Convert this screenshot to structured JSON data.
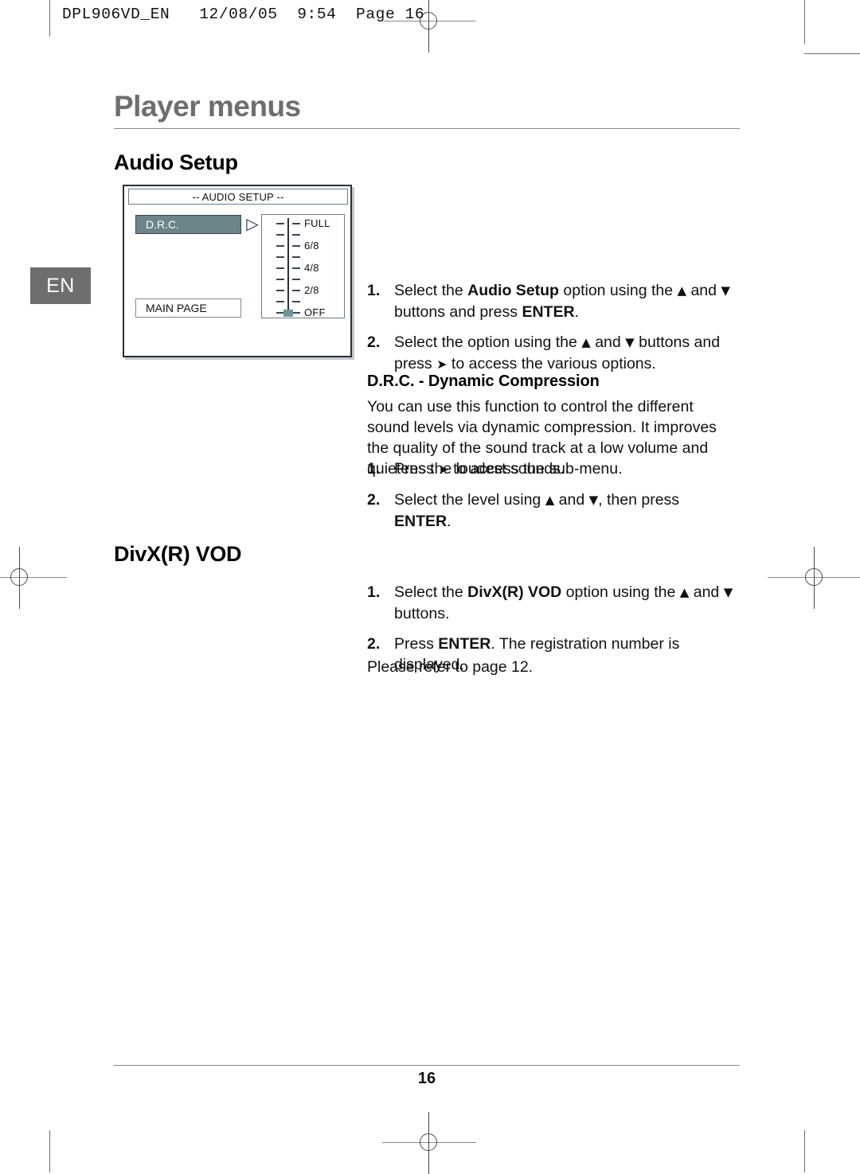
{
  "print_slug": "DPL906VD_EN   12/08/05  9:54  Page 16",
  "language_tab": "EN",
  "chapter_title": "Player menus",
  "sections": {
    "audio_setup": {
      "heading": "Audio Setup",
      "steps": [
        {
          "number": "1.",
          "parts": [
            {
              "t": "Select the ",
              "b": false
            },
            {
              "t": "Audio Setup",
              "b": true
            },
            {
              "t": " option using the ",
              "b": false
            },
            {
              "t": "▲",
              "icon": "up-arrow-icon"
            },
            {
              "t": " and ",
              "b": false
            },
            {
              "t": "▼",
              "icon": "down-arrow-icon"
            },
            {
              "t": " buttons and press ",
              "b": false
            },
            {
              "t": "ENTER",
              "b": true
            },
            {
              "t": ".",
              "b": false
            }
          ]
        },
        {
          "number": "2.",
          "parts": [
            {
              "t": "Select the option using the ",
              "b": false
            },
            {
              "t": "▲",
              "icon": "up-arrow-icon"
            },
            {
              "t": " and ",
              "b": false
            },
            {
              "t": "▼",
              "icon": "down-arrow-icon"
            },
            {
              "t": " buttons and press ",
              "b": false
            },
            {
              "t": "➤",
              "icon": "right-arrow-icon"
            },
            {
              "t": " to access the various options.",
              "b": false
            }
          ]
        }
      ],
      "subsection": {
        "heading": "D.R.C. - Dynamic Compression",
        "body": "You can use this function to control the different sound levels via dynamic compression. It improves the quality of the sound track at a low volume and quietens the loudest sounds.",
        "steps": [
          {
            "number": "1.",
            "parts": [
              {
                "t": "Press ",
                "b": false
              },
              {
                "t": "➤",
                "icon": "right-arrow-icon"
              },
              {
                "t": " to access the sub-menu.",
                "b": false
              }
            ]
          },
          {
            "number": "2.",
            "parts": [
              {
                "t": "Select the level using ",
                "b": false
              },
              {
                "t": "▲",
                "icon": "up-arrow-icon"
              },
              {
                "t": " and ",
                "b": false
              },
              {
                "t": "▼",
                "icon": "down-arrow-icon"
              },
              {
                "t": ", then press ",
                "b": false
              },
              {
                "t": "ENTER",
                "b": true
              },
              {
                "t": ".",
                "b": false
              }
            ]
          }
        ]
      }
    },
    "divx_vod": {
      "heading": "DivX(R) VOD",
      "steps": [
        {
          "number": "1.",
          "parts": [
            {
              "t": "Select the ",
              "b": false
            },
            {
              "t": "DivX(R) VOD",
              "b": true
            },
            {
              "t": " option using the ",
              "b": false
            },
            {
              "t": "▲",
              "icon": "up-arrow-icon"
            },
            {
              "t": " and ",
              "b": false
            },
            {
              "t": "▼",
              "icon": "down-arrow-icon"
            },
            {
              "t": " buttons.",
              "b": false
            }
          ]
        },
        {
          "number": "2.",
          "parts": [
            {
              "t": "Press ",
              "b": false
            },
            {
              "t": "ENTER",
              "b": true
            },
            {
              "t": ". The registration number is displayed.",
              "b": false
            }
          ]
        }
      ],
      "note": "Please refer to page 12."
    }
  },
  "osd_menu": {
    "title": "-- AUDIO SETUP --",
    "selected_item": "D.R.C.",
    "arrow_icon": "▷",
    "main_page_item": "MAIN PAGE",
    "slider": {
      "rows": [
        {
          "label": "FULL",
          "marked": false
        },
        {
          "label": "",
          "marked": false
        },
        {
          "label": "6/8",
          "marked": false
        },
        {
          "label": "",
          "marked": false
        },
        {
          "label": "4/8",
          "marked": false
        },
        {
          "label": "",
          "marked": false
        },
        {
          "label": "2/8",
          "marked": false
        },
        {
          "label": "",
          "marked": false
        },
        {
          "label": "OFF",
          "marked": true
        }
      ],
      "current_value": "OFF"
    }
  },
  "footer": {
    "page_number": "16"
  },
  "colors": {
    "chapter_title": "#6e6e6e",
    "lang_tab_bg": "#6e6e6e",
    "osd_highlight": "#6d8489",
    "osd_border": "#2b2f3a",
    "slider_knob": "#70949a",
    "rule": "#8c8c8c"
  }
}
